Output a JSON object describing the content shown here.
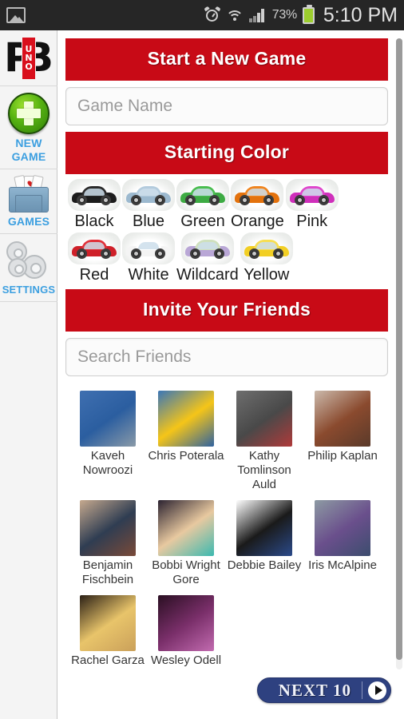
{
  "statusbar": {
    "icons": [
      "gallery-icon",
      "alarm-icon",
      "wifi-icon",
      "signal-icon"
    ],
    "battery_percent": "73%",
    "time": "5:10 PM"
  },
  "sidebar": {
    "logo": {
      "left": "P",
      "right": "B",
      "badge": [
        "U",
        "N",
        "O"
      ]
    },
    "items": [
      {
        "id": "new-game",
        "label_lines": [
          "NEW",
          "GAME"
        ],
        "icon": "green-plus-icon"
      },
      {
        "id": "games",
        "label_lines": [
          "GAMES"
        ],
        "icon": "folder-cards-icon"
      },
      {
        "id": "settings",
        "label_lines": [
          "SETTINGS"
        ],
        "icon": "gears-icon"
      }
    ],
    "label_color": "#3c9fe0"
  },
  "main": {
    "banner_color": "#c80a16",
    "sections": [
      {
        "id": "start-new-game",
        "title": "Start a New Game"
      },
      {
        "id": "starting-color",
        "title": "Starting Color"
      },
      {
        "id": "invite-friends",
        "title": "Invite Your Friends"
      }
    ],
    "game_name_input": {
      "placeholder": "Game Name",
      "value": ""
    },
    "search_friends_input": {
      "placeholder": "Search Friends",
      "value": ""
    },
    "colors": [
      {
        "label": "Black",
        "hex": "#1c1c1c",
        "roof": "#2a2a2a"
      },
      {
        "label": "Blue",
        "hex": "#9cb9cf",
        "roof": "#b3cbdd"
      },
      {
        "label": "Green",
        "hex": "#3dab43",
        "roof": "#49bd4f"
      },
      {
        "label": "Orange",
        "hex": "#e3720d",
        "roof": "#f0851f"
      },
      {
        "label": "Pink",
        "hex": "#cf2fbb",
        "roof": "#df47cc"
      },
      {
        "label": "Red",
        "hex": "#cf2029",
        "roof": "#e03039"
      },
      {
        "label": "White",
        "hex": "#f4f4f4",
        "roof": "#ffffff"
      },
      {
        "label": "Wildcard",
        "hex": "#b9a7d6",
        "roof": "#cfe0bd"
      },
      {
        "label": "Yellow",
        "hex": "#f2cf24",
        "roof": "#f7de52"
      }
    ],
    "friends": [
      {
        "name": "Kaveh Nowroozi",
        "avatar_colors": [
          "#3f6fb0",
          "#2b5ea0",
          "#8a9aa8"
        ]
      },
      {
        "name": "Chris Poterala",
        "avatar_colors": [
          "#3a76b8",
          "#f5c518",
          "#2f62a0"
        ]
      },
      {
        "name": "Kathy Tomlinson Auld",
        "avatar_colors": [
          "#6e6e6e",
          "#494949",
          "#b03a3a"
        ]
      },
      {
        "name": "Philip Kaplan",
        "avatar_colors": [
          "#cbb9ab",
          "#8a4a2e",
          "#5a3a2a"
        ]
      },
      {
        "name": "Benjamin Fischbein",
        "avatar_colors": [
          "#c6a98e",
          "#2f3d52",
          "#7a4a38"
        ]
      },
      {
        "name": "Bobbi Wright Gore",
        "avatar_colors": [
          "#2b2230",
          "#e8c9a0",
          "#3bb9b0"
        ]
      },
      {
        "name": "Debbie Bailey",
        "avatar_colors": [
          "#ffffff",
          "#1a1a1a",
          "#2b4a8a"
        ]
      },
      {
        "name": "Iris McAlpine",
        "avatar_colors": [
          "#8d9aa3",
          "#6a4f8c",
          "#3c4d6e"
        ]
      },
      {
        "name": "Rachel Garza",
        "avatar_colors": [
          "#2b2016",
          "#e8c46a",
          "#caa05a"
        ]
      },
      {
        "name": "Wesley Odell",
        "avatar_colors": [
          "#2a0f22",
          "#7a2f6a",
          "#c26bb0"
        ]
      }
    ],
    "next_button": {
      "label": "NEXT 10",
      "icon": "play-arrow-icon",
      "color": "#2e4180"
    }
  }
}
